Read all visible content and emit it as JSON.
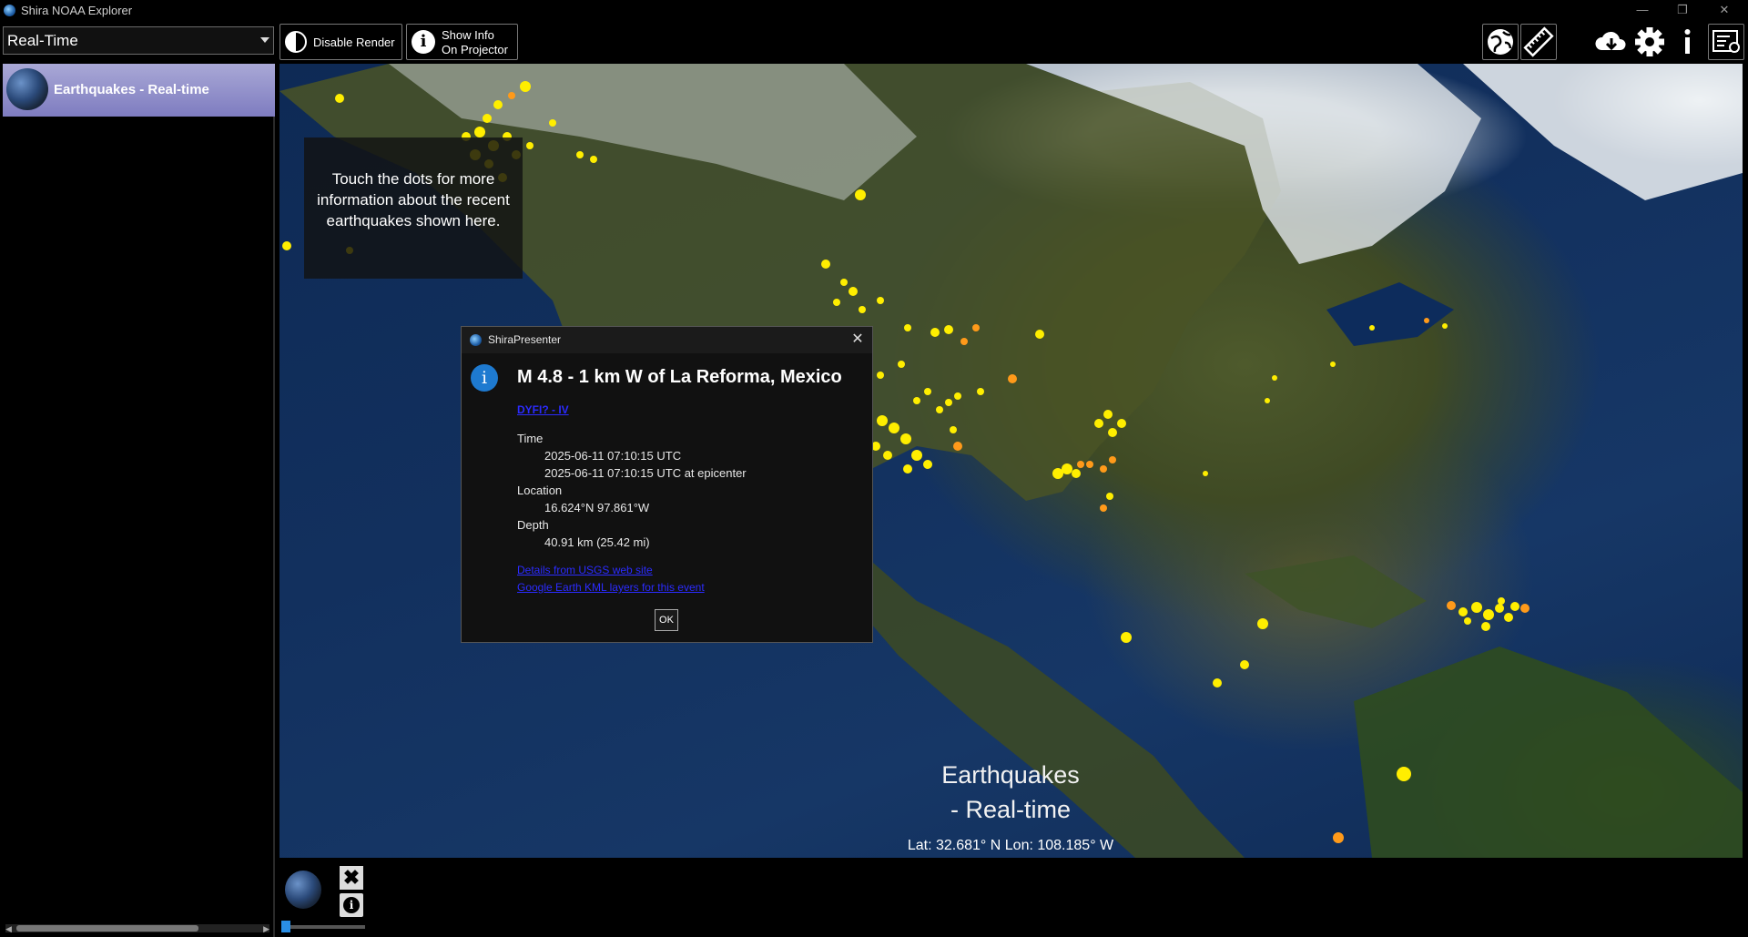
{
  "window": {
    "title": "Shira NOAA Explorer",
    "minimize": "—",
    "restore": "❐",
    "close": "✕"
  },
  "toolbar": {
    "dataset_selected": "Real-Time",
    "disable_render_label": "Disable Render",
    "show_info_label": "Show Info\nOn Projector",
    "icons": [
      "globe-icon",
      "ruler-icon",
      "cloud-download-icon",
      "gear-icon",
      "info-icon",
      "presenter-icon"
    ]
  },
  "sidebar": {
    "items": [
      {
        "label": "Earthquakes - Real-time",
        "selected": true
      }
    ]
  },
  "map": {
    "note": "Touch the dots for more information about the recent earthquakes shown here.",
    "title": "Earthquakes\n- Real-time",
    "coords": "Lat: 32.681° N   Lon: 108.185° W",
    "dot_colors": {
      "recent": "#ffee00",
      "older": "#ff9a1a"
    }
  },
  "dialog": {
    "app_name": "ShiraPresenter",
    "close_glyph": "✕",
    "info_glyph": "i",
    "heading": "M 4.8 - 1 km W of La Reforma, Mexico",
    "dyfi_link": "DYFI? - IV",
    "time_label": "Time",
    "time_utc": "2025-06-11 07:10:15 UTC",
    "time_epicenter": "2025-06-11 07:10:15 UTC at epicenter",
    "location_label": "Location",
    "location_value": "16.624°N 97.861°W",
    "depth_label": "Depth",
    "depth_value": "40.91 km (25.42 mi)",
    "usgs_link": "Details from USGS web site",
    "kml_link": "Google Earth KML layers for this event",
    "ok_label": "OK"
  },
  "bottom": {
    "close_glyph": "✖",
    "info_glyph": "i"
  }
}
